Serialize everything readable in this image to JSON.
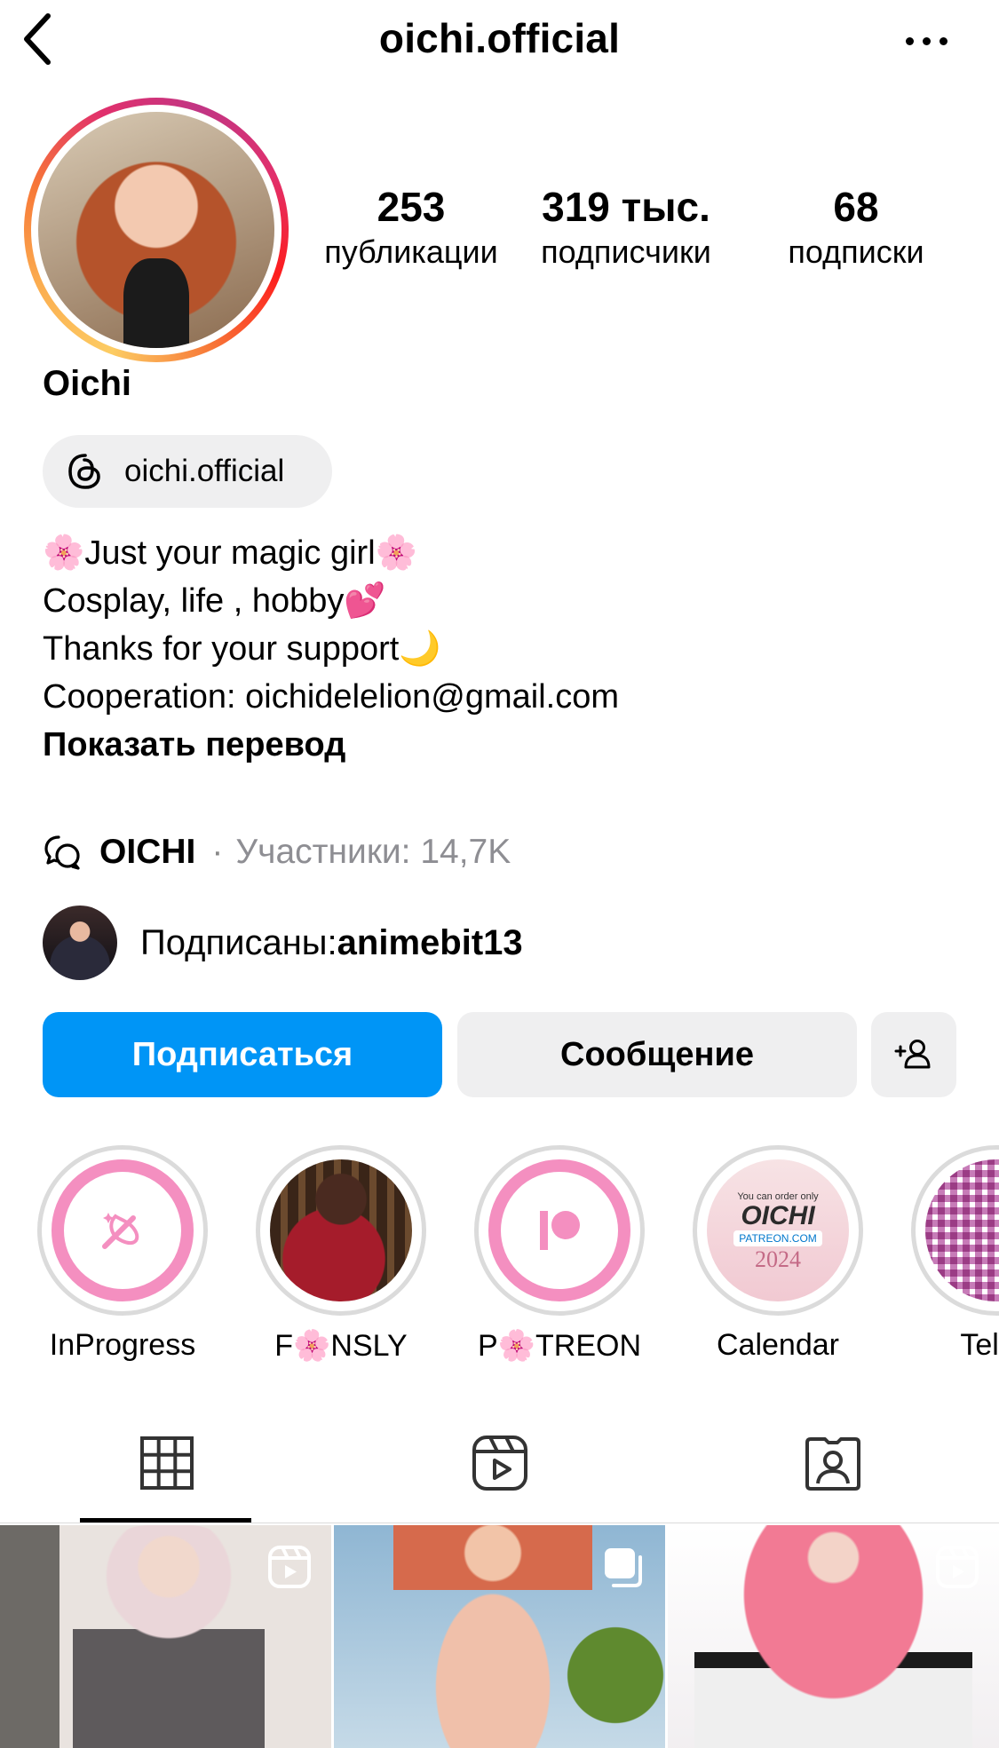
{
  "header": {
    "username": "oichi.official"
  },
  "stats": [
    {
      "value": "253",
      "label": "публикации"
    },
    {
      "value": "319 тыс.",
      "label": "подписчики"
    },
    {
      "value": "68",
      "label": "подписки"
    }
  ],
  "profile": {
    "name": "Oichi",
    "threads_handle": "oichi.official"
  },
  "bio": {
    "lines": [
      "🌸Just your magic girl🌸",
      "Cosplay, life , hobby💕",
      "Thanks for your support🌙",
      "Cooperation: oichidelelion@gmail.com"
    ],
    "translate_label": "Показать перевод"
  },
  "community": {
    "name": "OICHI",
    "separator": "·",
    "members": "Участники: 14,7K"
  },
  "followed_by": {
    "prefix": "Подписаны: ",
    "user": "animebit13"
  },
  "actions": {
    "follow_label": "Подписаться",
    "message_label": "Сообщение"
  },
  "highlights": [
    {
      "label": "InProgress",
      "icon": "sparkle-pen-icon"
    },
    {
      "label": "F🌸NSLY",
      "icon": "photo"
    },
    {
      "label": "P🌸TREON",
      "icon": "patreon-icon"
    },
    {
      "label": "Calendar",
      "icon": "calendar-cover"
    },
    {
      "label": "Teleg",
      "icon": "qr-code"
    }
  ],
  "calendar_cover": {
    "top": "You can order only",
    "brand": "OICHI",
    "link": "PATREON.COM",
    "year": "2024"
  },
  "colors": {
    "primary_button": "#0095f6",
    "secondary_button": "#efeff0",
    "highlight_pink": "#f48fc0",
    "muted_text": "#8e8e93"
  }
}
